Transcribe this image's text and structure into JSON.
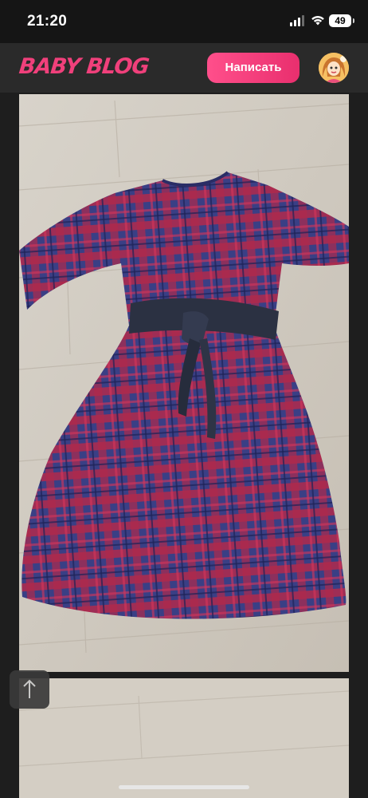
{
  "status_bar": {
    "time": "21:20",
    "battery": "49",
    "icons": [
      "signal-icon",
      "wifi-icon",
      "battery-icon"
    ]
  },
  "header": {
    "logo": "BABY BLOG",
    "write_button": "Написать",
    "avatar_icon": "user-avatar"
  },
  "feed": {
    "photos": [
      {
        "subject": "plaid-dress-photo"
      },
      {
        "subject": "floor-photo"
      }
    ]
  },
  "controls": {
    "scroll_top_icon": "arrow-up-icon"
  },
  "colors": {
    "accent": "#f0407b",
    "button": "#ff4f8b",
    "header_bg": "#2a2a2a",
    "status_bg": "#151515",
    "page_bg": "#1e1e1e"
  }
}
